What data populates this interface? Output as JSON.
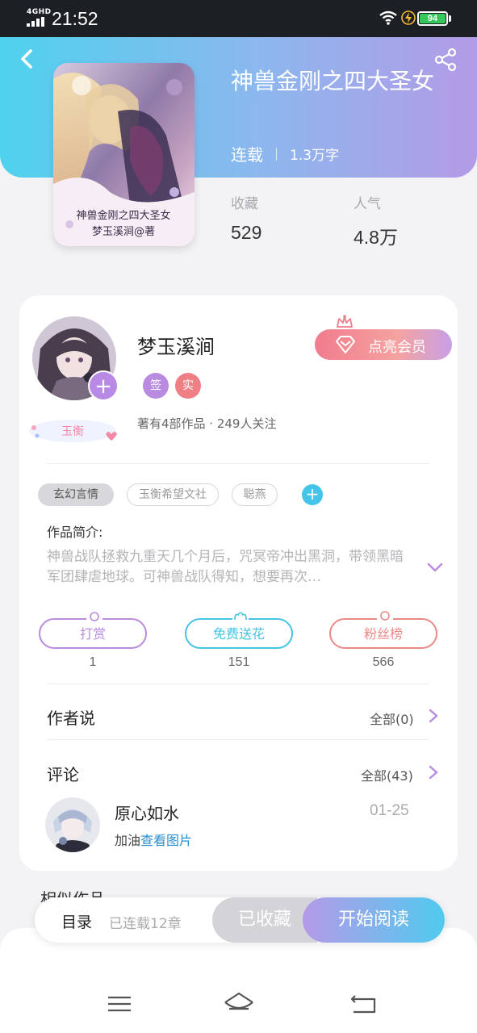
{
  "status_bar": {
    "network": "4GHD",
    "time": "21:52",
    "battery": "94"
  },
  "book": {
    "title": "神兽金刚之四大圣女",
    "status": "连载",
    "word_count": "1.3万字",
    "cover_text_line1": "神兽金刚之四大圣女",
    "cover_text_line2": "梦玉溪涧@著",
    "favorites_label": "收藏",
    "favorites_value": "529",
    "popularity_label": "人气",
    "popularity_value": "4.8万"
  },
  "author": {
    "name": "梦玉溪涧",
    "rank": "玉衡",
    "tag_sign": "签",
    "tag_real": "实",
    "info": "著有4部作品 · 249人关注",
    "vip_button": "点亮会员"
  },
  "tags": [
    "玄幻言情",
    "玉衡希望文社",
    "聪燕"
  ],
  "intro": {
    "label": "作品简介:",
    "text": "神兽战队拯救九重天几个月后，咒冥帝冲出黑洞，带领黑暗军团肆虐地球。可神兽战队得知，想要再次…"
  },
  "actions": [
    {
      "label": "打赏",
      "count": "1",
      "color": "#b98ae0"
    },
    {
      "label": "免费送花",
      "count": "151",
      "color": "#45c4e4"
    },
    {
      "label": "粉丝榜",
      "count": "566",
      "color": "#ea8a86"
    }
  ],
  "author_says": {
    "title": "作者说",
    "link": "全部(0)"
  },
  "comments": {
    "title": "评论",
    "link": "全部(43)",
    "items": [
      {
        "user": "原心如水",
        "date": "01-25",
        "text": "加油",
        "link": "查看图片"
      }
    ]
  },
  "similar": {
    "title": "相似作品"
  },
  "bottom_bar": {
    "catalog": "目录",
    "serial_count": "已连载12章",
    "collected": "已收藏",
    "read": "开始阅读"
  },
  "colors": {
    "accent_purple": "#b88ae6",
    "accent_cyan": "#4fd2ef",
    "link_blue": "#2a8fd0"
  }
}
